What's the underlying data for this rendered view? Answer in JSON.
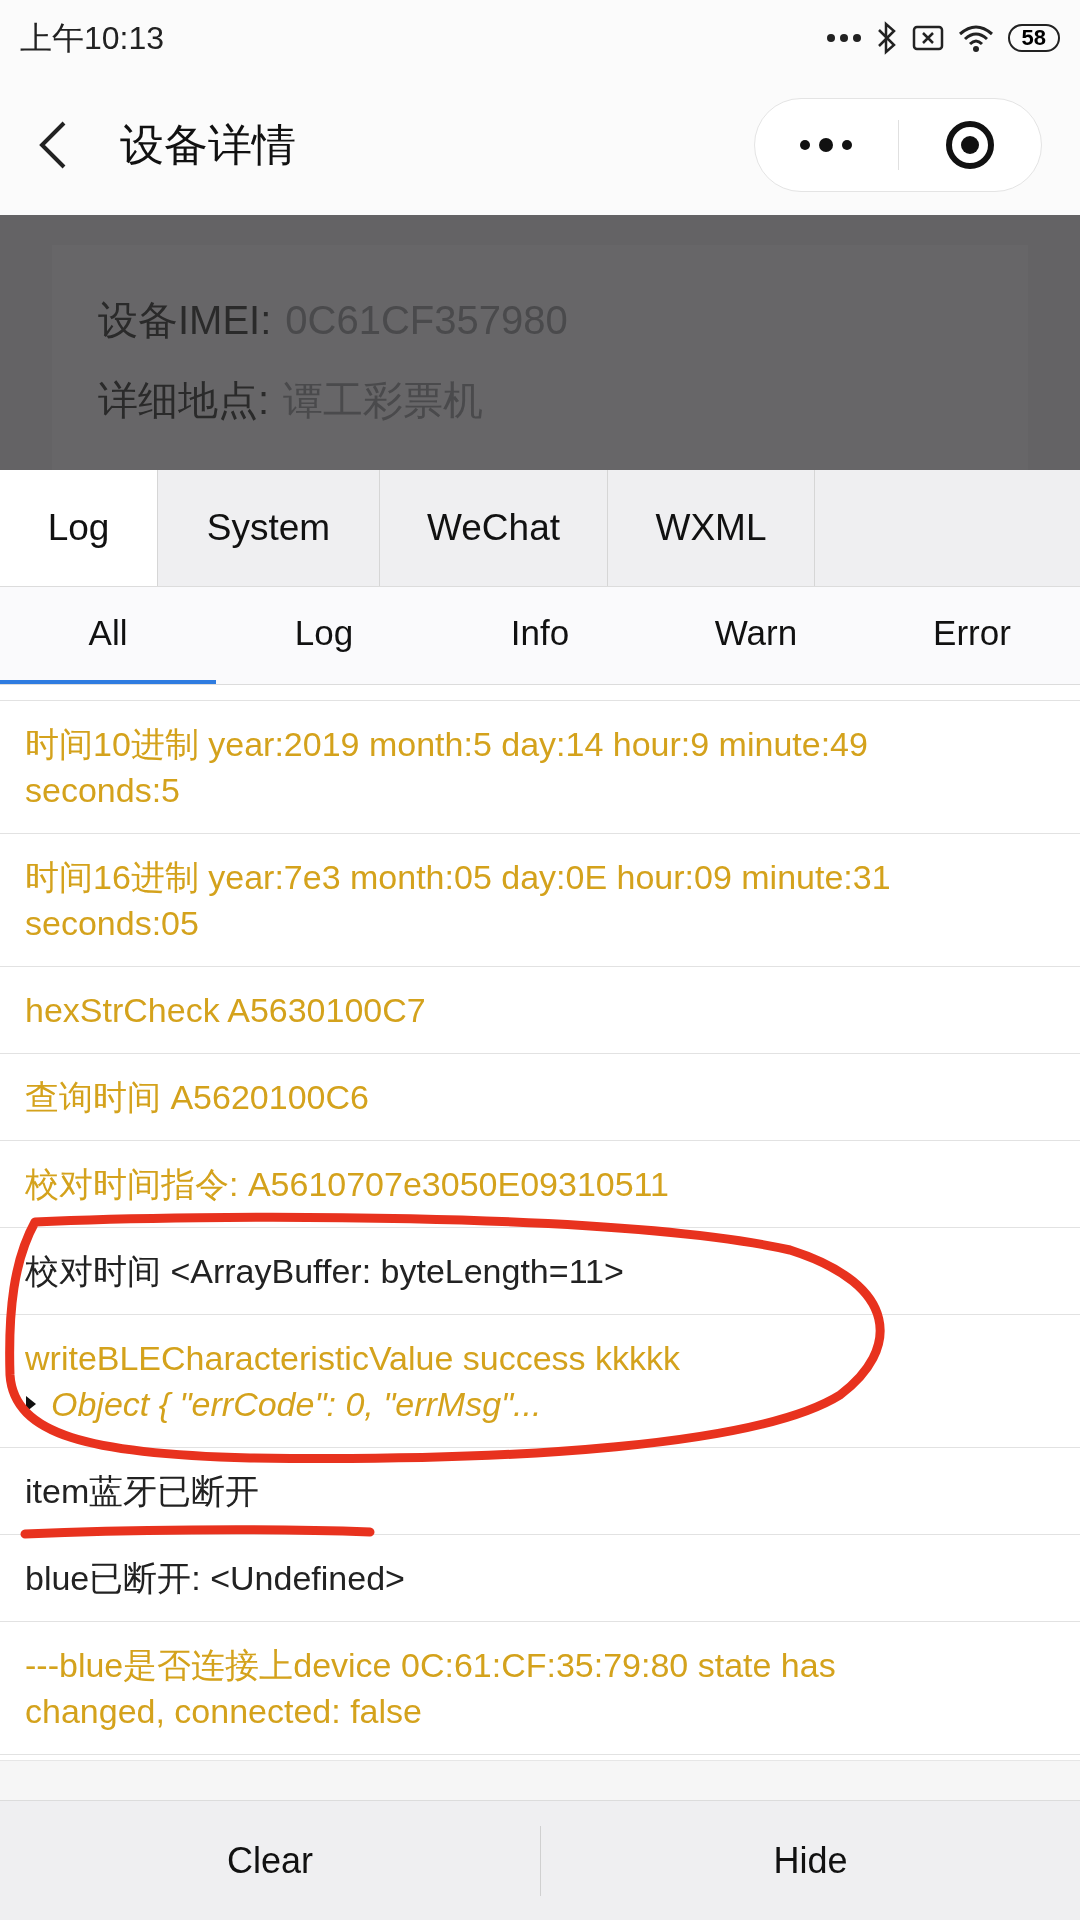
{
  "status_bar": {
    "time": "上午10:13",
    "battery": "58"
  },
  "nav": {
    "title": "设备详情"
  },
  "device_card": {
    "fields": [
      {
        "label": "设备IMEI:",
        "value": "0C61CF357980"
      },
      {
        "label": "详细地点:",
        "value": "谭工彩票机"
      }
    ]
  },
  "tabs": [
    {
      "label": "Log",
      "selected": true
    },
    {
      "label": "System",
      "selected": false
    },
    {
      "label": "WeChat",
      "selected": false
    },
    {
      "label": "WXML",
      "selected": false
    }
  ],
  "filters": [
    {
      "label": "All",
      "selected": true
    },
    {
      "label": "Log",
      "selected": false
    },
    {
      "label": "Info",
      "selected": false
    },
    {
      "label": "Warn",
      "selected": false
    },
    {
      "label": "Error",
      "selected": false
    }
  ],
  "log_entries": [
    {
      "kind": "warn",
      "text": "时间10进制 year:2019 month:5 day:14 hour:9 minute:49 seconds:5"
    },
    {
      "kind": "warn",
      "text": "时间16进制 year:7e3 month:05 day:0E hour:09 minute:31 seconds:05"
    },
    {
      "kind": "warn",
      "text": "hexStrCheck A5630100C7"
    },
    {
      "kind": "warn",
      "text": "查询时间 A5620100C6"
    },
    {
      "kind": "warn",
      "text": "校对时间指令: A5610707e3050E09310511"
    },
    {
      "kind": "log",
      "text": "校对时间 <ArrayBuffer: byteLength=11>"
    },
    {
      "kind": "warn",
      "text": "writeBLECharacteristicValue success kkkkk",
      "object": "Object { \"errCode\": 0, \"errMsg\"...",
      "expanded": false
    },
    {
      "kind": "log",
      "text": "item蓝牙已断开"
    },
    {
      "kind": "log",
      "text": "blue已断开: <Undefined>"
    },
    {
      "kind": "warn",
      "text": "---blue是否连接上device 0C:61:CF:35:79:80 state has changed, connected: false"
    }
  ],
  "buttons": [
    {
      "label": "Clear"
    },
    {
      "label": "Hide"
    }
  ]
}
